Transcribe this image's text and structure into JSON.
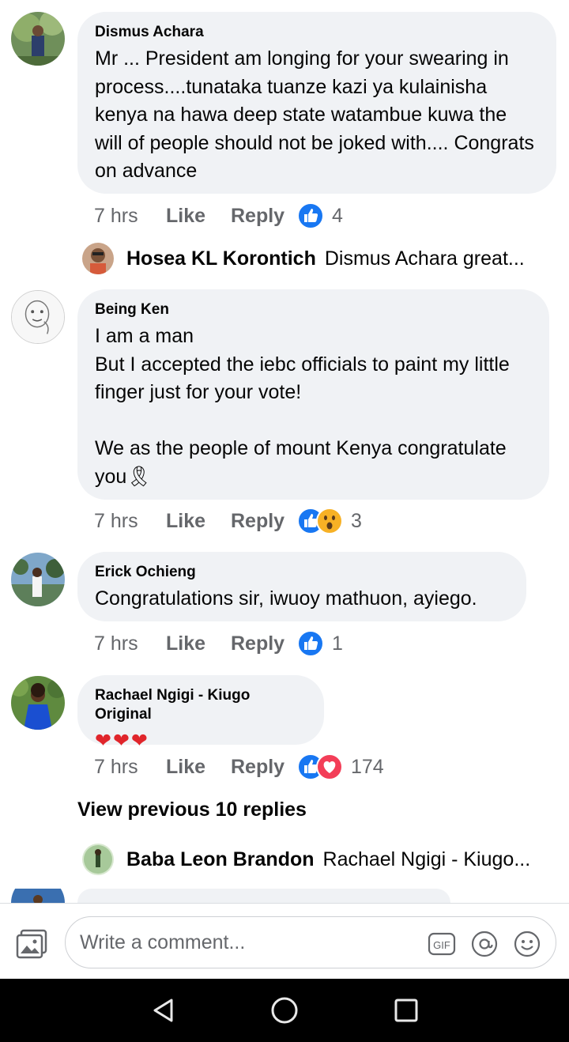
{
  "comments": [
    {
      "author": "Dismus Achara",
      "text": "Mr ... President am longing for your swearing in process....tunataka tuanze kazi ya kulainisha kenya na hawa deep state watambue kuwa the will of people should not be joked with.... Congrats on advance",
      "time": "7 hrs",
      "like": "Like",
      "reply": "Reply",
      "reactions": [
        "like"
      ],
      "count": "4"
    },
    {
      "author": "Being Ken",
      "text": "I am a man\nBut I accepted the iebc officials  to paint my little finger just for your vote!\n\nWe as the people of mount Kenya congratulate you🎗",
      "time": "7 hrs",
      "like": "Like",
      "reply": "Reply",
      "reactions": [
        "like",
        "wow"
      ],
      "count": "3"
    },
    {
      "author": "Erick Ochieng",
      "text": "Congratulations sir, iwuoy mathuon,  ayiego.",
      "time": "7 hrs",
      "like": "Like",
      "reply": "Reply",
      "reactions": [
        "like"
      ],
      "count": "1"
    },
    {
      "author": "Rachael Ngigi - Kiugo Original",
      "text": "❤❤❤",
      "time": "7 hrs",
      "like": "Like",
      "reply": "Reply",
      "reactions": [
        "like",
        "love"
      ],
      "count": "174"
    }
  ],
  "replies": [
    {
      "name": "Hosea KL Korontich",
      "preview": "Dismus Achara great..."
    },
    {
      "name": "Baba Leon Brandon",
      "preview": "Rachael Ngigi - Kiugo..."
    }
  ],
  "view_previous": "View previous 10 replies",
  "composer": {
    "placeholder": "Write a comment...",
    "gif_label": "GIF"
  },
  "colors": {
    "bubble": "#f0f2f5",
    "like_blue": "#1877f2",
    "love_red": "#f33e58",
    "wow_yellow": "#f7b125",
    "meta_gray": "#65676b"
  },
  "icons": [
    "gallery-icon",
    "gif-icon",
    "mention-icon",
    "emoji-icon",
    "back-nav-icon",
    "home-nav-icon",
    "recents-nav-icon"
  ]
}
